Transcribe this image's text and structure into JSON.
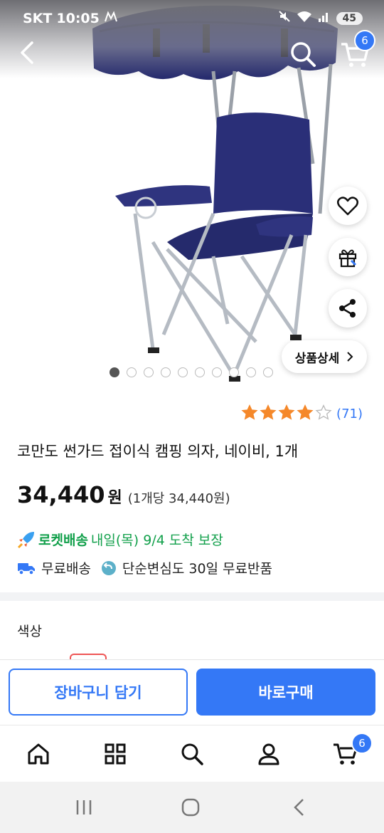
{
  "status_bar": {
    "carrier": "SKT",
    "time": "10:05",
    "battery": "45"
  },
  "header": {
    "cart_count": "6"
  },
  "gallery": {
    "total_images": 10,
    "active_index": 0,
    "detail_button_label": "상품상세"
  },
  "product": {
    "rating_stars": 4,
    "rating_max": 5,
    "review_count": "(71)",
    "title": "코만도 썬가드 접이식 캠핑 의자, 네이비, 1개",
    "price": "34,440",
    "price_currency": "원",
    "unit_price": "(1개당 34,440원)"
  },
  "delivery": {
    "rocket_label": "로켓배송",
    "arrival_text": "내일(목) 9/4 도착 보장",
    "free_shipping": "무료배송",
    "free_return": "단순변심도 30일 무료반품"
  },
  "options": {
    "color_label": "색상"
  },
  "actions": {
    "add_to_cart": "장바구니 담기",
    "buy_now": "바로구매"
  },
  "tab_bar": {
    "cart_count": "6"
  },
  "colors": {
    "accent": "#3478f6",
    "rocket_green": "#12a04b",
    "star": "#f5882a",
    "chair_navy": "#2a2f78"
  }
}
